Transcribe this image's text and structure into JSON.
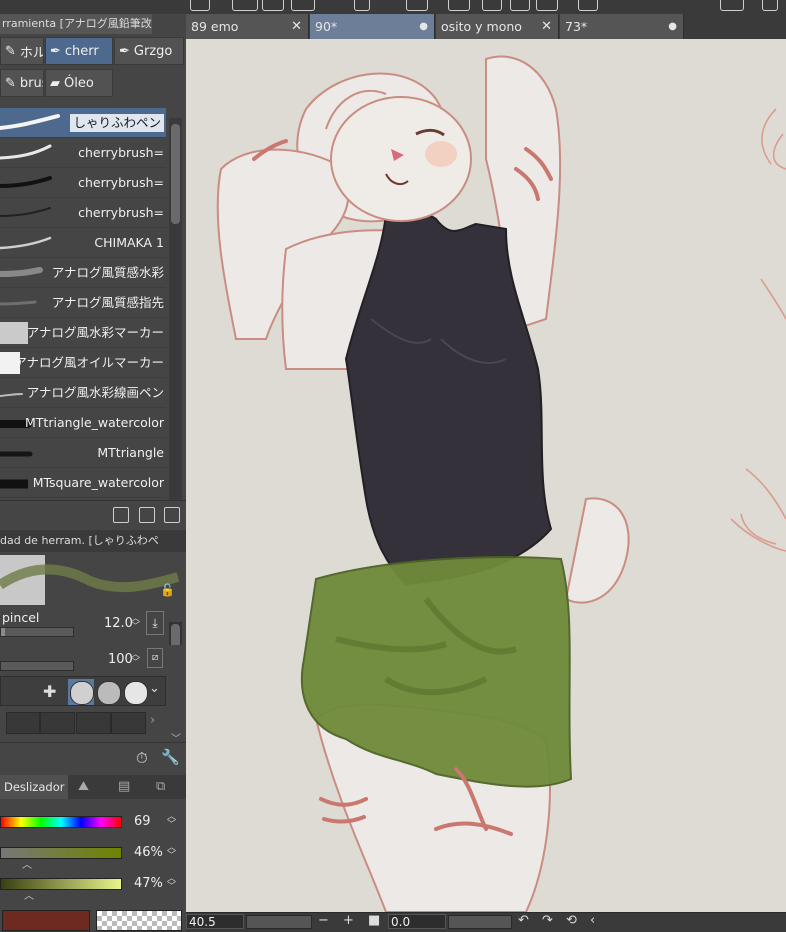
{
  "subtool": {
    "header": "rramienta [アナログ風鉛筆改]",
    "buttons": [
      "ホルダ",
      "cherr",
      "Grzgo",
      "brush",
      "Óleo"
    ]
  },
  "brushes": [
    {
      "label": "しゃりふわペン",
      "active": true
    },
    {
      "label": "cherrybrush=",
      "active": false
    },
    {
      "label": "cherrybrush=",
      "active": false
    },
    {
      "label": "cherrybrush=",
      "active": false
    },
    {
      "label": "CHIMAKA 1",
      "active": false
    },
    {
      "label": "アナログ風質感水彩",
      "active": false
    },
    {
      "label": "アナログ風質感指先",
      "active": false
    },
    {
      "label": "アナログ風水彩マーカー",
      "active": false
    },
    {
      "label": "アナログ風オイルマーカー",
      "active": false
    },
    {
      "label": "アナログ風水彩線画ペン",
      "active": false
    },
    {
      "label": "MTtriangle_watercolor",
      "active": false
    },
    {
      "label": "MTtriangle",
      "active": false
    },
    {
      "label": "MTsquare_watercolor",
      "active": false
    }
  ],
  "properties": {
    "header": "dad de herram. [しゃりふわペ",
    "brush_size_label": "pincel",
    "brush_size_value": "12.0",
    "brush_size_level": 0.05,
    "opacity_value": "100",
    "opacity_level": 1.0
  },
  "color": {
    "tab_label": "Deslizador",
    "hue_value": "69",
    "saturation_value": "46%",
    "brightness_value": "47%",
    "main_color": "#6e2a20",
    "hue_bar_colors": [
      "#ff0000",
      "#ffff00",
      "#00ff00",
      "#00ffff",
      "#0000ff",
      "#ff00ff",
      "#ff0000"
    ],
    "saturation_bar_colors": [
      "#777777",
      "#708400"
    ],
    "brightness_bar_colors": [
      "#3a3f12",
      "#e9f58a"
    ]
  },
  "tabs": [
    {
      "label": "89 emo",
      "close": "✕",
      "active": false
    },
    {
      "label": "90*",
      "close": "●",
      "active": true
    },
    {
      "label": "osito y mono",
      "close": "✕",
      "active": false
    },
    {
      "label": "73*",
      "close": "●",
      "active": false
    }
  ],
  "bottom": {
    "zoom": "40.5",
    "rotation": "0.0"
  },
  "icons": [
    "layer-folder-icon",
    "new-layer-icon",
    "delete-icon",
    "lock-icon",
    "wrench-icon",
    "transparent-swatch-icon",
    "undo-icon",
    "redo-icon",
    "reset-rotation-icon"
  ]
}
